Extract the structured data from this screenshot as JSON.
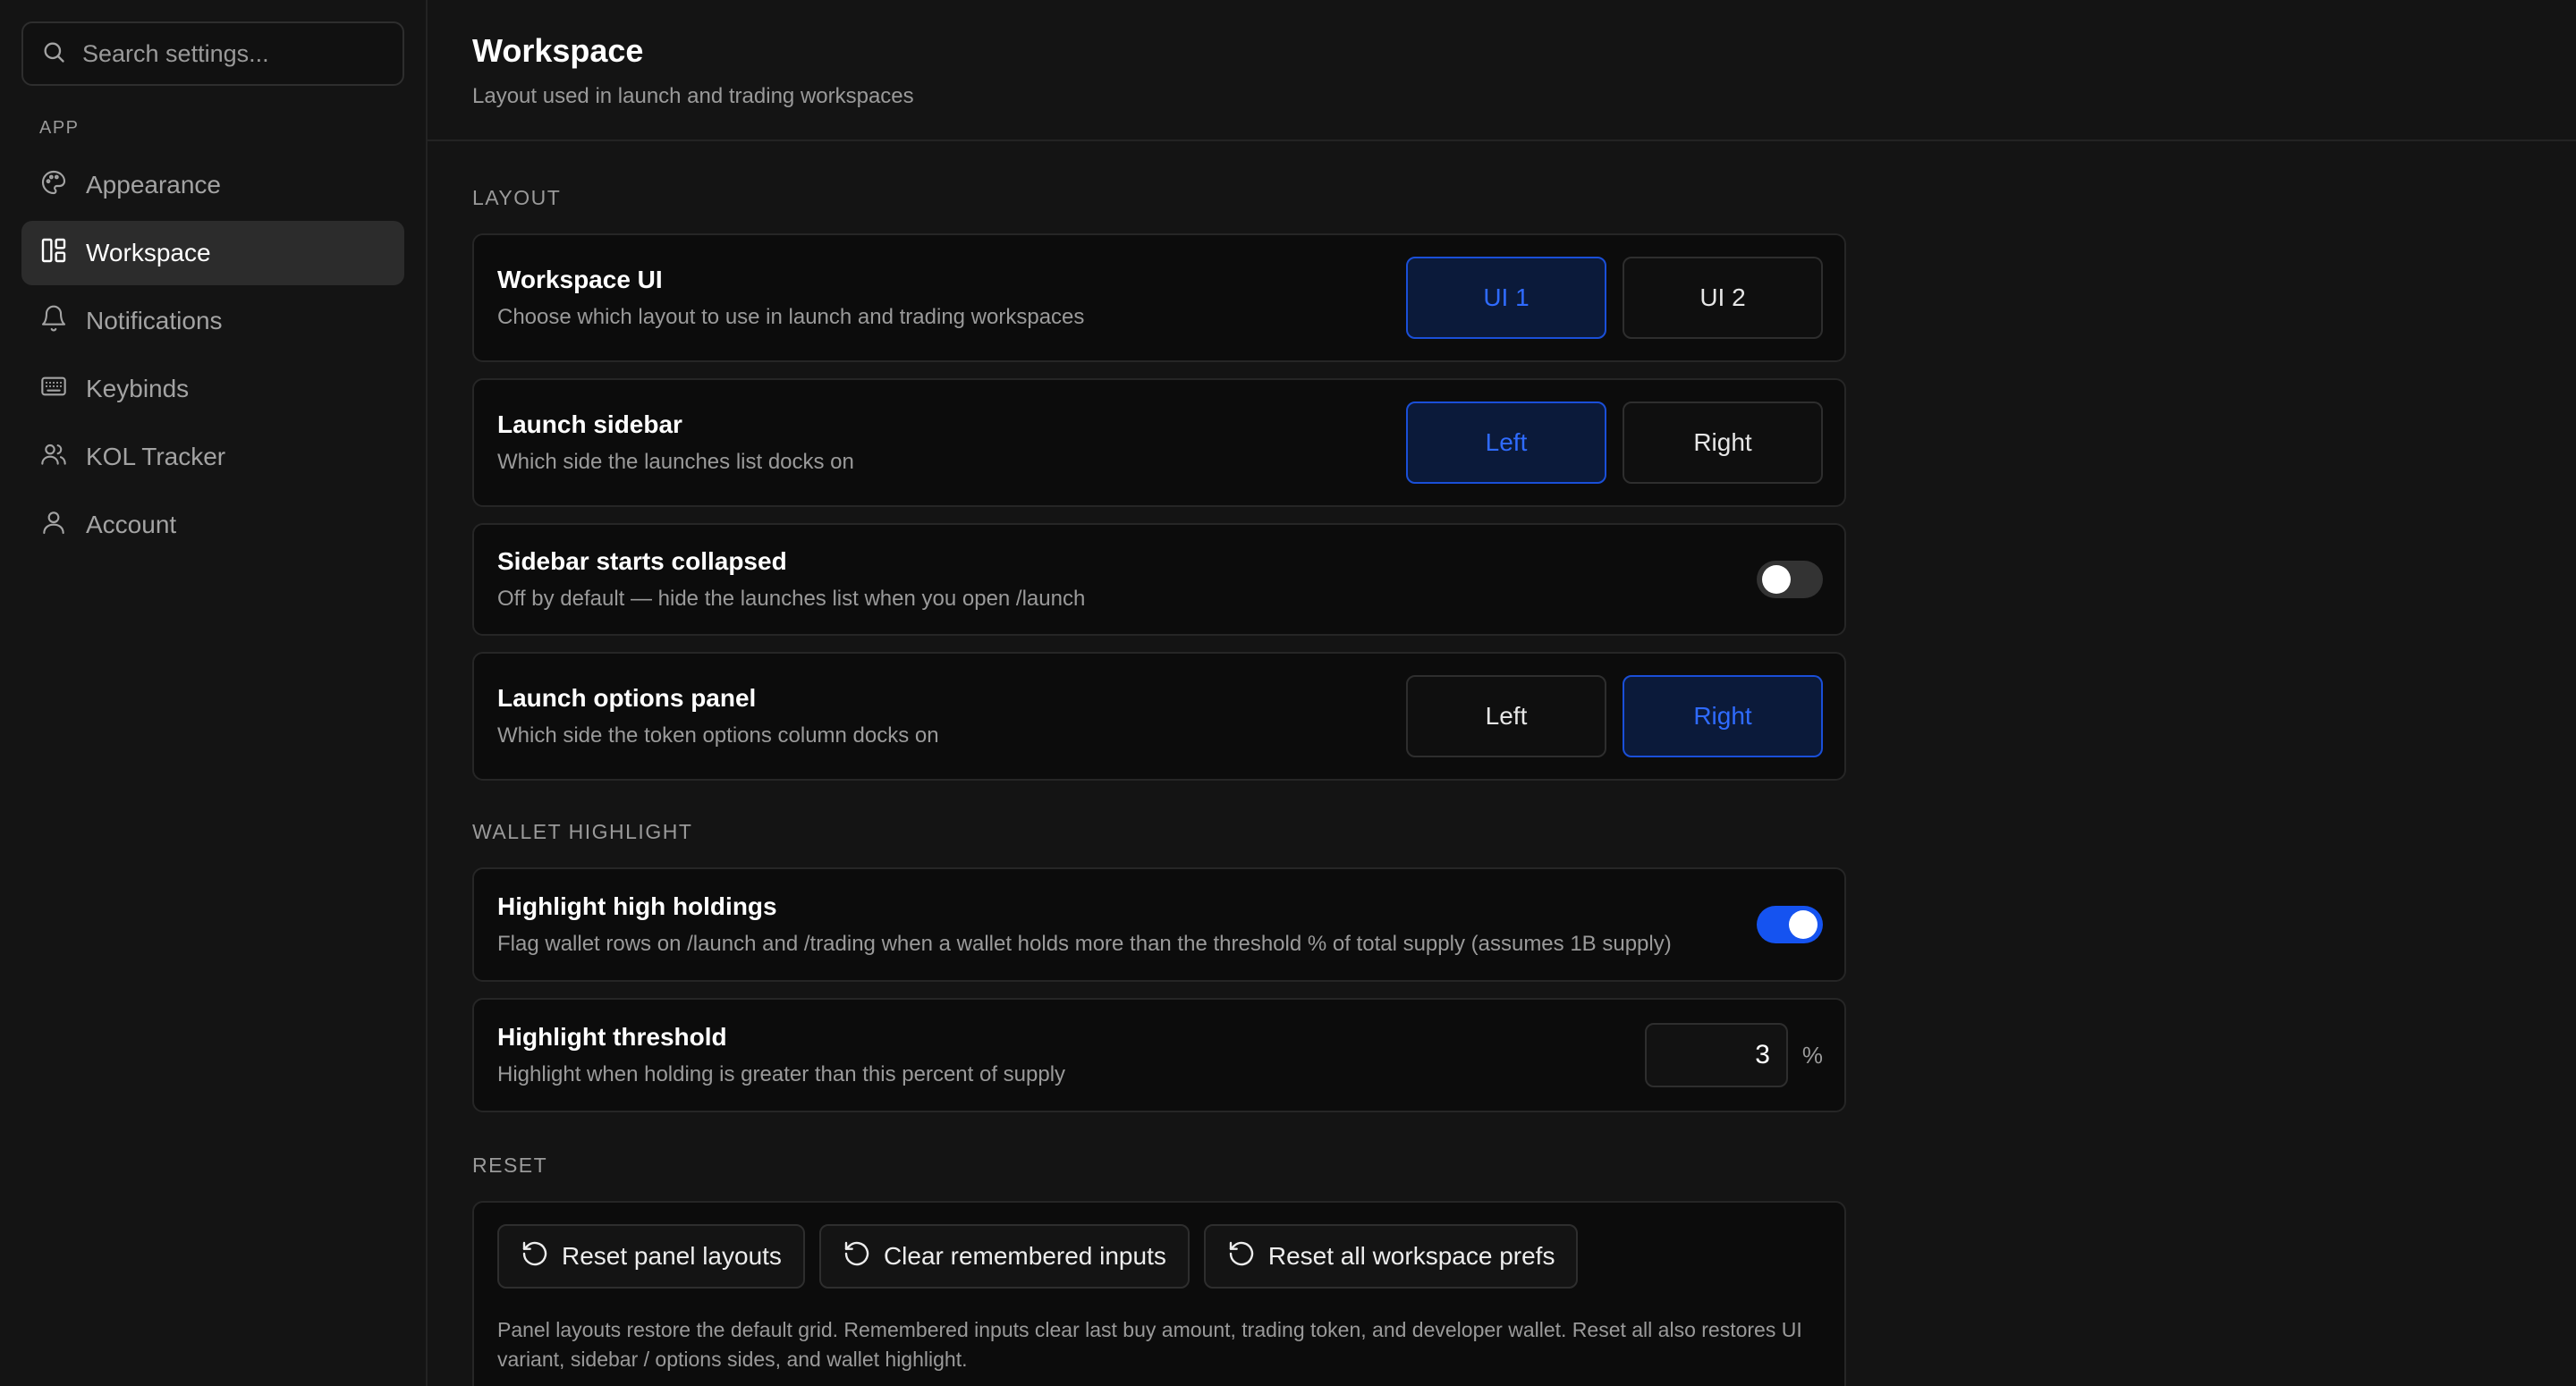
{
  "search": {
    "placeholder": "Search settings..."
  },
  "sidebar": {
    "section_label": "APP",
    "items": [
      {
        "label": "Appearance",
        "icon": "palette-icon",
        "active": false
      },
      {
        "label": "Workspace",
        "icon": "layout-icon",
        "active": true
      },
      {
        "label": "Notifications",
        "icon": "bell-icon",
        "active": false
      },
      {
        "label": "Keybinds",
        "icon": "keyboard-icon",
        "active": false
      },
      {
        "label": "KOL Tracker",
        "icon": "users-icon",
        "active": false
      },
      {
        "label": "Account",
        "icon": "user-icon",
        "active": false
      }
    ]
  },
  "header": {
    "title": "Workspace",
    "subtitle": "Layout used in launch and trading workspaces"
  },
  "layout": {
    "section_label": "LAYOUT",
    "workspace_ui": {
      "title": "Workspace UI",
      "desc": "Choose which layout to use in launch and trading workspaces",
      "options": [
        "UI 1",
        "UI 2"
      ],
      "selected": "UI 1"
    },
    "launch_sidebar": {
      "title": "Launch sidebar",
      "desc": "Which side the launches list docks on",
      "options": [
        "Left",
        "Right"
      ],
      "selected": "Left"
    },
    "sidebar_collapsed": {
      "title": "Sidebar starts collapsed",
      "desc": "Off by default — hide the launches list when you open /launch",
      "enabled": false
    },
    "options_panel": {
      "title": "Launch options panel",
      "desc": "Which side the token options column docks on",
      "options": [
        "Left",
        "Right"
      ],
      "selected": "Right"
    }
  },
  "wallet": {
    "section_label": "WALLET HIGHLIGHT",
    "high_holdings": {
      "title": "Highlight high holdings",
      "desc": "Flag wallet rows on /launch and /trading when a wallet holds more than the threshold % of total supply (assumes 1B supply)",
      "enabled": true
    },
    "threshold": {
      "title": "Highlight threshold",
      "desc": "Highlight when holding is greater than this percent of supply",
      "value": "3",
      "unit": "%"
    }
  },
  "reset": {
    "section_label": "RESET",
    "buttons": [
      "Reset panel layouts",
      "Clear remembered inputs",
      "Reset all workspace prefs"
    ],
    "note": "Panel layouts restore the default grid. Remembered inputs clear last buy amount, trading token, and developer wallet. Reset all also restores UI variant, sidebar / options sides, and wallet highlight."
  },
  "colors": {
    "accent": "#1553f0",
    "accent_text": "#2f6bff",
    "background": "#141414",
    "card": "#0c0c0c"
  }
}
